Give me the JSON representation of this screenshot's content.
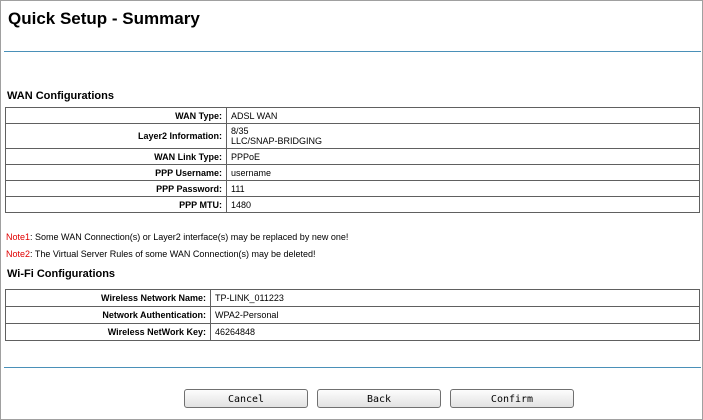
{
  "page": {
    "title": "Quick Setup - Summary"
  },
  "wan": {
    "section_title": "WAN Configurations",
    "rows": [
      {
        "label": "WAN Type:",
        "value": "ADSL WAN"
      },
      {
        "label": "Layer2 Information:",
        "value_lines": [
          "8/35",
          "LLC/SNAP-BRIDGING"
        ]
      },
      {
        "label": "WAN Link Type:",
        "value": "PPPoE"
      },
      {
        "label": "PPP Username:",
        "value": "username"
      },
      {
        "label": "PPP Password:",
        "value": "111"
      },
      {
        "label": "PPP MTU:",
        "value": "1480"
      }
    ]
  },
  "notes": [
    {
      "tag": "Note1",
      "text": ": Some WAN Connection(s) or Layer2 interface(s) may be replaced by new one!"
    },
    {
      "tag": "Note2",
      "text": ": The Virtual Server Rules of some WAN Connection(s) may be deleted!"
    }
  ],
  "wifi": {
    "section_title": "Wi-Fi Configurations",
    "rows": [
      {
        "label": "Wireless Network Name:",
        "value": "TP-LINK_011223"
      },
      {
        "label": "Network Authentication:",
        "value": "WPA2-Personal"
      },
      {
        "label": "Wireless NetWork Key:",
        "value": "46264848"
      }
    ]
  },
  "buttons": {
    "cancel": "Cancel",
    "back": "Back",
    "confirm": "Confirm"
  },
  "colors": {
    "rule": "#4a90b8",
    "note_tag": "#e00000",
    "border": "#606060"
  }
}
